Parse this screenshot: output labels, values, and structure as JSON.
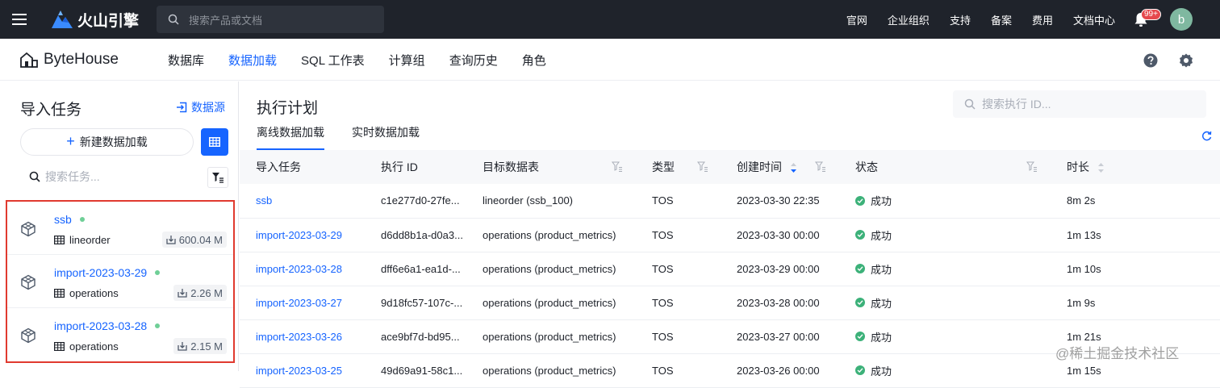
{
  "topbar": {
    "brand": "火山引擎",
    "search_placeholder": "搜索产品或文档",
    "links": [
      "官网",
      "企业组织",
      "支持",
      "备案",
      "费用",
      "文档中心"
    ],
    "notification_badge": "99+",
    "avatar_letter": "b"
  },
  "product": {
    "logo": "ByteHouse",
    "nav": [
      "数据库",
      "数据加载",
      "SQL 工作表",
      "计算组",
      "查询历史",
      "角色"
    ],
    "active_nav": "数据加载"
  },
  "left": {
    "title": "导入任务",
    "datasource_link": "数据源",
    "new_button": "新建数据加载",
    "search_placeholder": "搜索任务...",
    "tasks": [
      {
        "name": "ssb",
        "table": "lineorder",
        "size": "600.04 M"
      },
      {
        "name": "import-2023-03-29",
        "table": "operations",
        "size": "2.26 M"
      },
      {
        "name": "import-2023-03-28",
        "table": "operations",
        "size": "2.15 M"
      }
    ]
  },
  "main": {
    "title": "执行计划",
    "search_placeholder": "搜索执行 ID...",
    "tabs": [
      "离线数据加载",
      "实时数据加载"
    ],
    "columns": [
      "导入任务",
      "执行 ID",
      "目标数据表",
      "类型",
      "创建时间",
      "状态",
      "时长"
    ],
    "rows": [
      {
        "task": "ssb",
        "id": "c1e277d0-27fe...",
        "table": "lineorder (ssb_100)",
        "type": "TOS",
        "created": "2023-03-30 22:35",
        "status": "成功",
        "duration": "8m 2s"
      },
      {
        "task": "import-2023-03-29",
        "id": "d6dd8b1a-d0a3...",
        "table": "operations (product_metrics)",
        "type": "TOS",
        "created": "2023-03-30 00:00",
        "status": "成功",
        "duration": "1m 13s"
      },
      {
        "task": "import-2023-03-28",
        "id": "dff6e6a1-ea1d-...",
        "table": "operations (product_metrics)",
        "type": "TOS",
        "created": "2023-03-29 00:00",
        "status": "成功",
        "duration": "1m 10s"
      },
      {
        "task": "import-2023-03-27",
        "id": "9d18fc57-107c-...",
        "table": "operations (product_metrics)",
        "type": "TOS",
        "created": "2023-03-28 00:00",
        "status": "成功",
        "duration": "1m 9s"
      },
      {
        "task": "import-2023-03-26",
        "id": "ace9bf7d-bd95...",
        "table": "operations (product_metrics)",
        "type": "TOS",
        "created": "2023-03-27 00:00",
        "status": "成功",
        "duration": "1m 21s"
      },
      {
        "task": "import-2023-03-25",
        "id": "49d69a91-58c1...",
        "table": "operations (product_metrics)",
        "type": "TOS",
        "created": "2023-03-26 00:00",
        "status": "成功",
        "duration": "1m 15s"
      }
    ]
  },
  "watermark": "@稀土掘金技术社区",
  "colors": {
    "accent": "#1664ff",
    "topbar": "#1f232b",
    "success": "#3cb179",
    "highlight_border": "#e03a2f"
  }
}
